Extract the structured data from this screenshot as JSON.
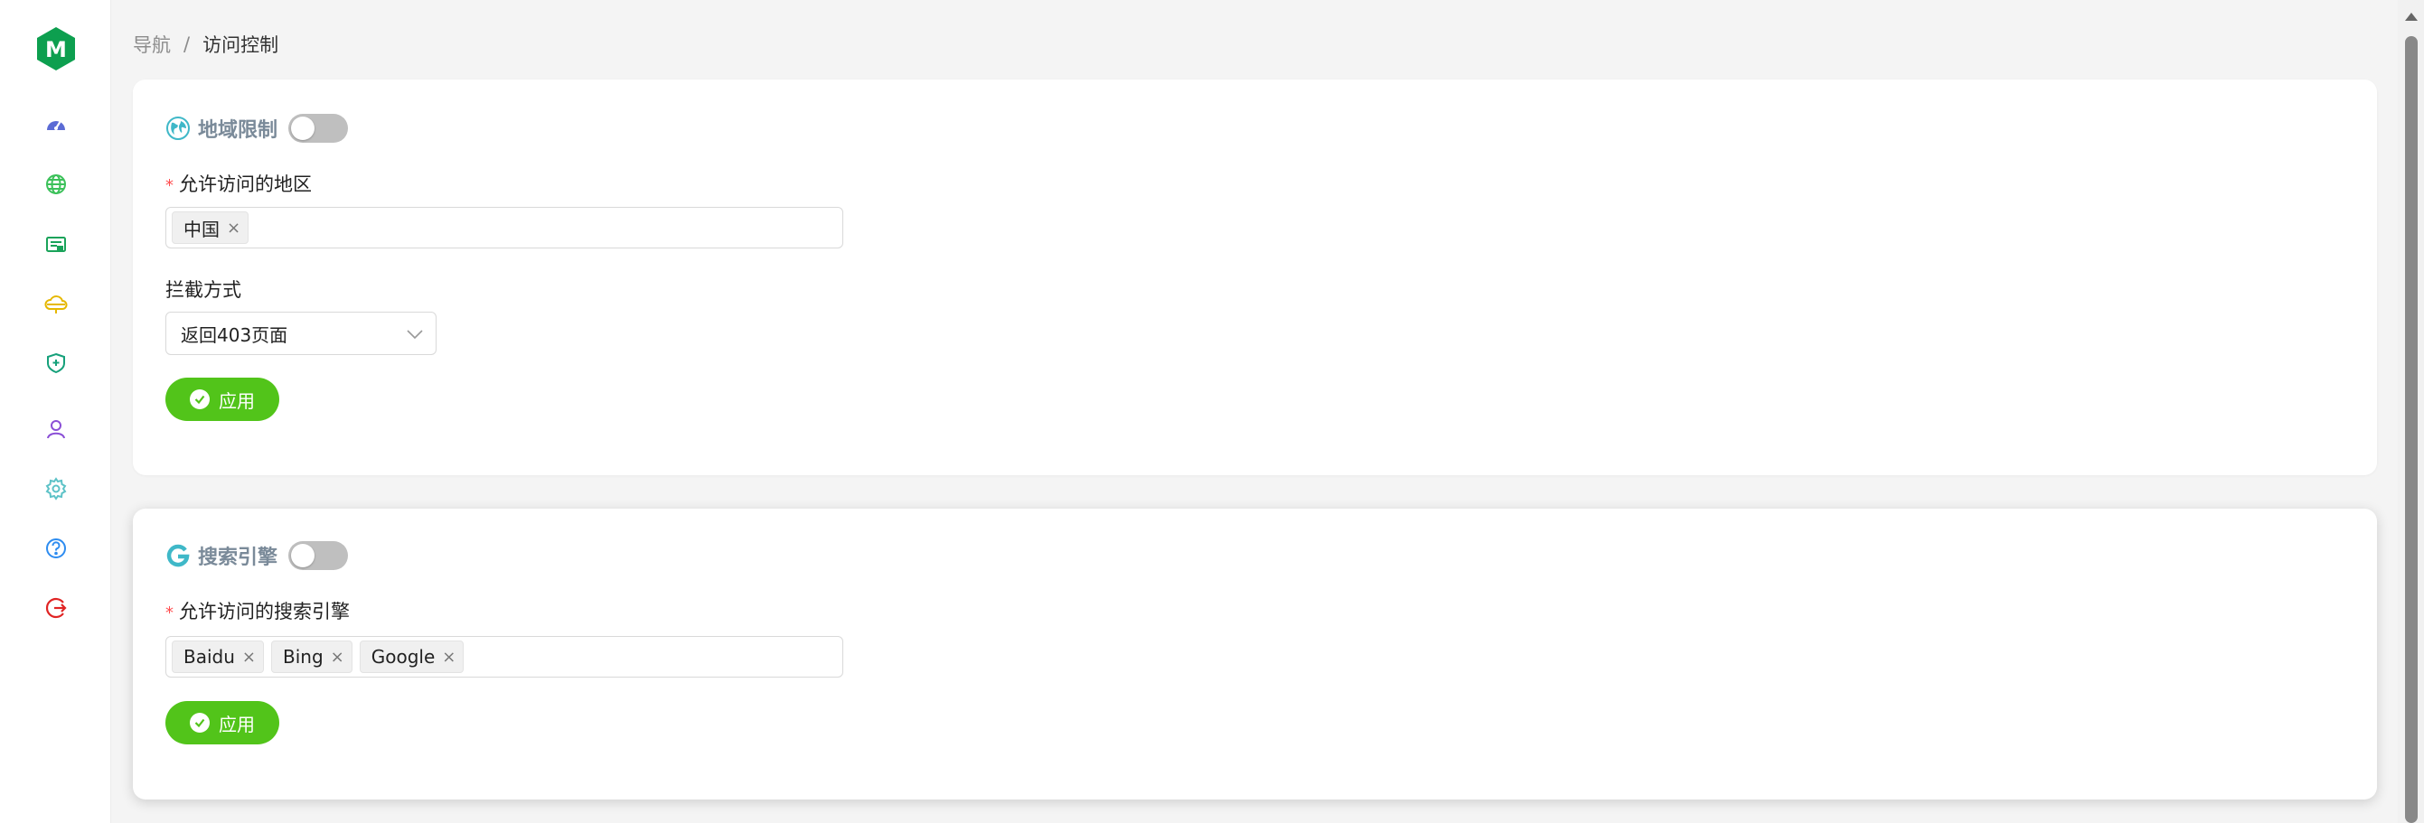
{
  "app": {
    "logo_letter": "M",
    "brand_color": "#0d9f4f"
  },
  "sidebar": {
    "items": [
      {
        "icon": "dashboard-icon",
        "color": "#5b6bd5"
      },
      {
        "icon": "globe-icon",
        "color": "#3cc15a"
      },
      {
        "icon": "website-list-icon",
        "color": "#1aa35a"
      },
      {
        "icon": "cloud-shield-icon",
        "color": "#e6b800"
      },
      {
        "icon": "shield-plus-icon",
        "color": "#15a07a"
      },
      {
        "icon": "user-icon",
        "color": "#8b4fd6"
      },
      {
        "icon": "gear-icon",
        "color": "#5cc2c7"
      },
      {
        "icon": "help-icon",
        "color": "#2d8cf0"
      },
      {
        "icon": "logout-icon",
        "color": "#e02424"
      }
    ]
  },
  "breadcrumb": {
    "root": "导航",
    "separator": "/",
    "current": "访问控制"
  },
  "geo_section": {
    "title": "地域限制",
    "icon": "earth-icon",
    "enabled": false,
    "allowed_regions_label": "允许访问的地区",
    "allowed_regions": [
      "中国"
    ],
    "block_mode_label": "拦截方式",
    "block_mode_value": "返回403页面",
    "apply_label": "应用"
  },
  "search_section": {
    "title": "搜索引擎",
    "icon": "google-g-icon",
    "enabled": false,
    "allowed_engines_label": "允许访问的搜索引擎",
    "allowed_engines": [
      "Baidu",
      "Bing",
      "Google"
    ],
    "apply_label": "应用"
  },
  "colors": {
    "apply_button": "#52c41a",
    "toggle_off": "#bfbfbf",
    "required": "#ff4d4f",
    "title_gray": "#7a8a99"
  }
}
